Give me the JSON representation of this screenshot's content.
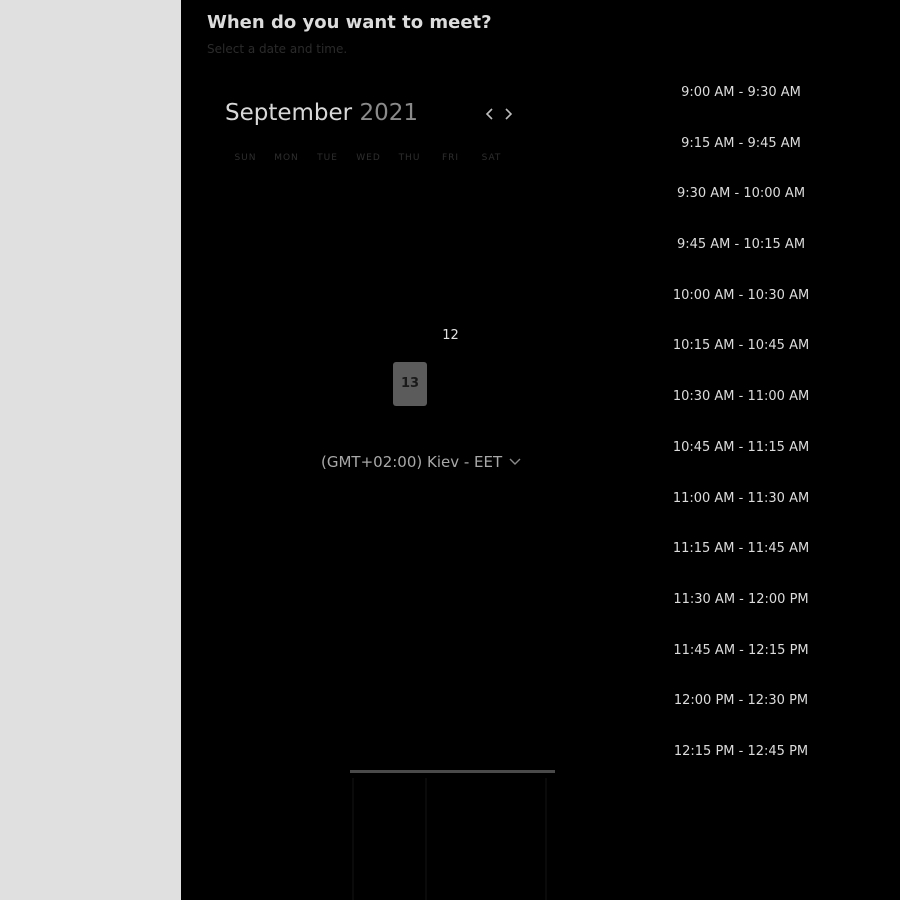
{
  "header": {
    "title": "When do you want to meet?",
    "subtitle": "Select a date and time."
  },
  "calendar": {
    "month": "September",
    "year": "2021",
    "weekdays": [
      "SUN",
      "MON",
      "TUE",
      "WED",
      "THU",
      "FRI",
      "SAT"
    ],
    "available_day": "12",
    "selected_day": "13",
    "prev_icon": "chevron-left-icon",
    "next_icon": "chevron-right-icon"
  },
  "timezone": {
    "label": "(GMT+02:00) Kiev - EET",
    "icon": "chevron-down-icon"
  },
  "time_slots": [
    "9:00 AM - 9:30 AM",
    "9:15 AM - 9:45 AM",
    "9:30 AM - 10:00 AM",
    "9:45 AM - 10:15 AM",
    "10:00 AM - 10:30 AM",
    "10:15 AM - 10:45 AM",
    "10:30 AM - 11:00 AM",
    "10:45 AM - 11:15 AM",
    "11:00 AM - 11:30 AM",
    "11:15 AM - 11:45 AM",
    "11:30 AM - 12:00 PM",
    "11:45 AM - 12:15 PM",
    "12:00 PM - 12:30 PM",
    "12:15 PM - 12:45 PM"
  ],
  "colors": {
    "panel_background": "#000000",
    "page_background": "#e0e0e0",
    "selected_day_background": "#5b5b5b"
  }
}
